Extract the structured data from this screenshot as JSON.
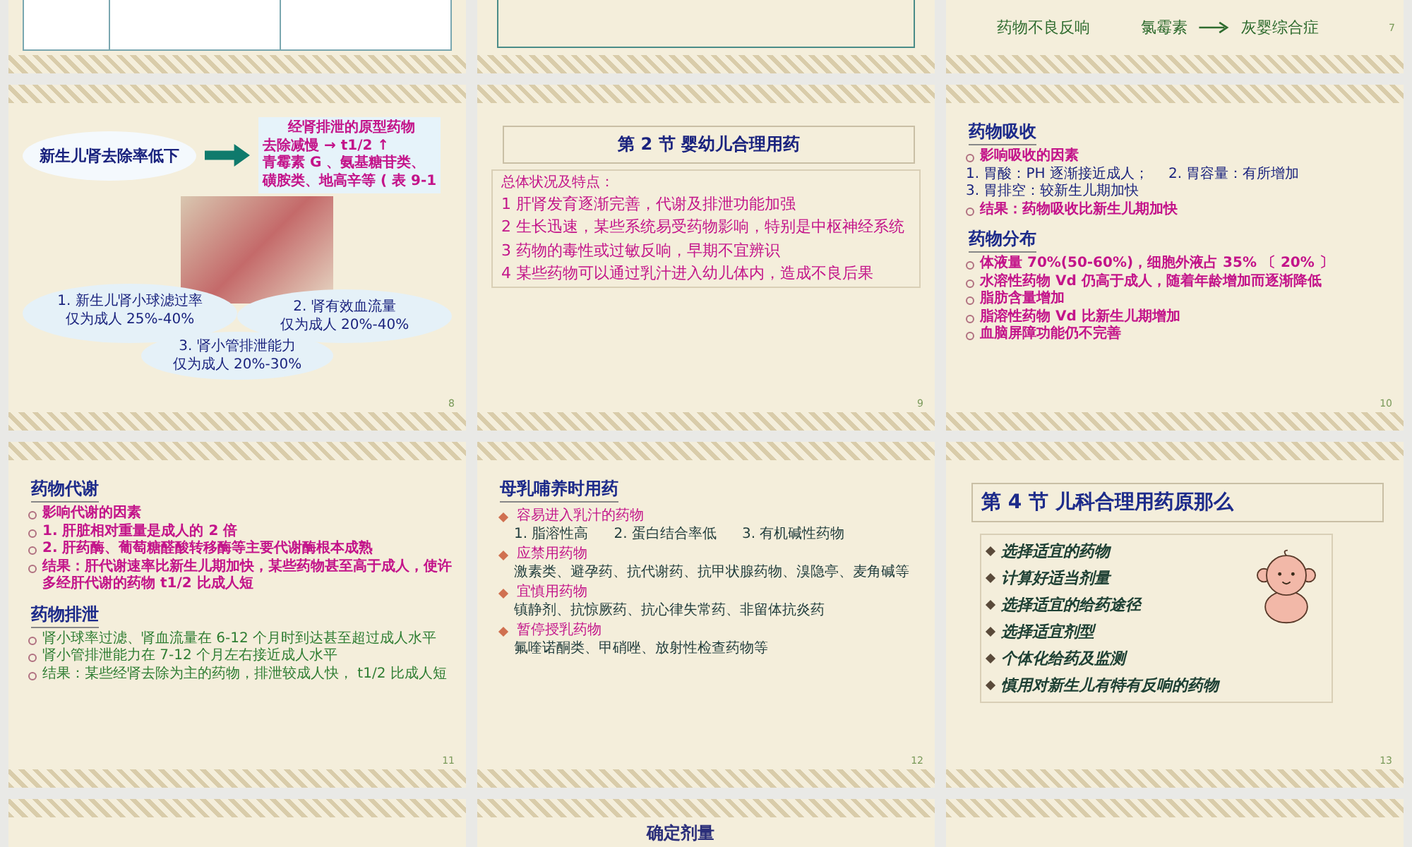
{
  "slides": [
    {
      "kind": "partial-table"
    },
    {
      "kind": "partial-box"
    },
    {
      "kind": "partial-reaction",
      "cause": "药物不良反响",
      "drug": "氯霉素",
      "effect": "灰婴综合症",
      "number": "7"
    },
    {
      "kind": "kidney",
      "lead": "新生儿肾去除率低下",
      "callout": [
        "经肾排泄的原型药物",
        "去除减慢 → t1/2 ↑",
        "青霉素 G 、氨基糖苷类、",
        "磺胺类、地高辛等 ( 表 9-1"
      ],
      "factors": [
        {
          "label": "1. 新生儿肾小球滤过率",
          "value": "仅为成人 25%-40%"
        },
        {
          "label": "2. 肾有效血流量",
          "value": "仅为成人 20%-40%"
        },
        {
          "label": "3. 肾小管排泄能力",
          "value": "仅为成人 20%-30%"
        }
      ],
      "number": "8"
    },
    {
      "kind": "section",
      "title": "第 2 节  婴幼儿合理用药",
      "intro": "总体状况及特点：",
      "points": [
        "1  肝肾发育逐渐完善，代谢及排泄功能加强",
        "2  生长迅速，某些系统易受药物影响，特别是中枢神经系统",
        "3  药物的毒性或过敏反响，早期不宜辨识",
        "4  某些药物可以通过乳汁进入幼儿体内，造成不良后果"
      ],
      "number": "9"
    },
    {
      "kind": "topics",
      "blocks": [
        {
          "heading": "药物吸收",
          "items": [
            {
              "kind": "bullet",
              "text": "影响吸收的因素"
            },
            {
              "kind": "plain",
              "parts": [
                "1. 胃酸：PH 逐渐接近成人；",
                "2. 胃容量：有所增加"
              ]
            },
            {
              "kind": "plain",
              "parts": [
                "3. 胃排空：较新生儿期加快"
              ]
            },
            {
              "kind": "bullet",
              "text": "结果：药物吸收比新生儿期加快"
            }
          ]
        },
        {
          "heading": "药物分布",
          "items": [
            {
              "kind": "bullet",
              "text": "体液量 70%(50-60%)，细胞外液占 35% 〔 20% 〕"
            },
            {
              "kind": "bullet",
              "text": "水溶性药物 Vd 仍高于成人，随着年龄增加而逐渐降低"
            },
            {
              "kind": "bullet",
              "text": "脂肪含量增加"
            },
            {
              "kind": "bullet",
              "text": "脂溶性药物 Vd 比新生儿期增加"
            },
            {
              "kind": "bullet",
              "text": "血脑屏障功能仍不完善"
            }
          ]
        }
      ],
      "number": "10"
    },
    {
      "kind": "topics",
      "blocks": [
        {
          "heading": "药物代谢",
          "items": [
            {
              "kind": "bullet",
              "text": "影响代谢的因素"
            },
            {
              "kind": "bullet",
              "text": "1. 肝脏相对重量是成人的 2 倍"
            },
            {
              "kind": "bullet",
              "text": "2. 肝药酶、葡萄糖醛酸转移酶等主要代谢酶根本成熟"
            },
            {
              "kind": "bullet",
              "text": "结果：肝代谢速率比新生儿期加快，某些药物甚至高于成人，使许多经肝代谢的药物 t1/2 比成人短"
            }
          ]
        },
        {
          "heading": "药物排泄",
          "items": [
            {
              "kind": "note",
              "text": "肾小球率过滤、肾血流量在 6-12 个月时到达甚至超过成人水平"
            },
            {
              "kind": "note",
              "text": "肾小管排泄能力在 7-12 个月左右接近成人水平"
            },
            {
              "kind": "note",
              "text": "结果：某些经肾去除为主的药物，排泄较成人快， t1/2 比成人短"
            }
          ]
        }
      ],
      "number": "11"
    },
    {
      "kind": "topics",
      "blocks": [
        {
          "heading": "母乳哺养时用药",
          "items": [
            {
              "kind": "diamond",
              "text": "容易进入乳汁的药物"
            },
            {
              "kind": "detail",
              "parts": [
                "1. 脂溶性高",
                "2. 蛋白结合率低",
                "3. 有机碱性药物"
              ]
            },
            {
              "kind": "diamond",
              "text": "应禁用药物"
            },
            {
              "kind": "detail",
              "parts": [
                "激素类、避孕药、抗代谢药、抗甲状腺药物、溴隐亭、麦角碱等"
              ]
            },
            {
              "kind": "diamond",
              "text": "宜慎用药物"
            },
            {
              "kind": "detail",
              "parts": [
                "镇静剂、抗惊厥药、抗心律失常药、非留体抗炎药"
              ]
            },
            {
              "kind": "diamond",
              "text": "暂停授乳药物"
            },
            {
              "kind": "detail",
              "parts": [
                "氟喹诺酮类、甲硝唑、放射性检查药物等"
              ]
            }
          ]
        }
      ],
      "number": "12"
    },
    {
      "kind": "principles",
      "title": "第 4 节  儿科合理用药原那么",
      "items": [
        "选择适宜的药物",
        "计算好适当剂量",
        "选择适宜的给药途径",
        "选择适宜剂型",
        "个体化给药及监测",
        "慎用对新生儿有特有反响的药物"
      ],
      "number": "13"
    },
    {
      "kind": "partial-top"
    },
    {
      "kind": "partial-title",
      "title": "确定剂量"
    },
    {
      "kind": "partial-top"
    }
  ]
}
